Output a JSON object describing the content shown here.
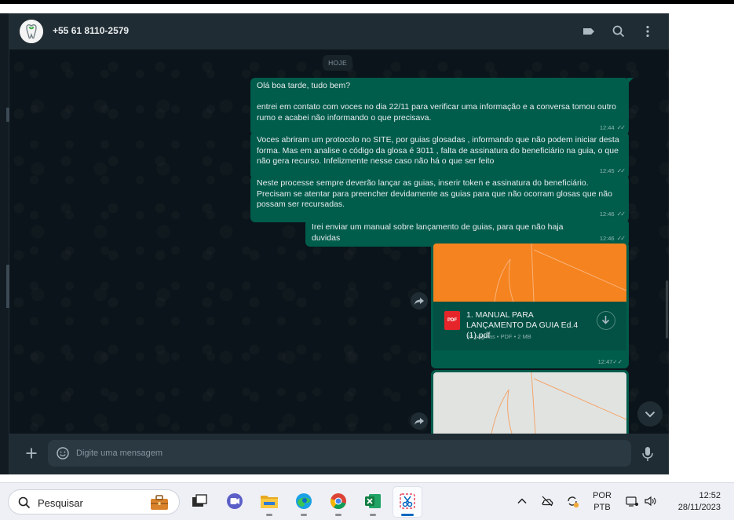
{
  "header": {
    "contact_name": "+55 61 8110-2579",
    "icons": [
      "tag-icon",
      "search-icon",
      "menu-dots-icon"
    ]
  },
  "date_chip": "HOJE",
  "messages": [
    {
      "text": "Olá boa tarde, tudo bem?\n\nentrei em contato com voces no dia 22/11 para verificar uma informação e a conversa tomou outro rumo e acabei não informando o que precisava.",
      "time": "12:44"
    },
    {
      "text": "Voces abriram um protocolo no SITE, por guias glosadas , informando que não podem iniciar desta forma. Mas em analise o código da glosa é 3011 , falta de assinatura do beneficiário na guia, o que não gera recurso. Infelizmente nesse caso não há o que ser feito",
      "time": "12:45"
    },
    {
      "text": "Neste processe sempre deverão lançar as guias, inserir token e assinatura do beneficiário.\nPrecisam se atentar para preencher devidamente as guias para que não ocorram glosas que não possam ser recursadas.",
      "time": "12:46"
    },
    {
      "text": "Irei enviar um manual sobre lançamento de guias, para que não haja duvidas",
      "time": "12:46"
    }
  ],
  "document": {
    "name": "1. MANUAL PARA LANÇAMENTO DA GUIA Ed.4 (1).pdf",
    "info": "10 páginas • PDF • 2 MB",
    "icon_label": "PDF",
    "time": "12:47"
  },
  "composer": {
    "placeholder": "Digite uma mensagem"
  },
  "taskbar": {
    "search_label": "Pesquisar",
    "lang_line1": "POR",
    "lang_line2": "PTB",
    "time": "12:52",
    "date": "28/11/2023"
  },
  "colors": {
    "chat_bg": "#0b141a",
    "header_bg": "#202c33",
    "outgoing_bubble": "#005c4b",
    "doc_thumb": "#f5831f"
  }
}
